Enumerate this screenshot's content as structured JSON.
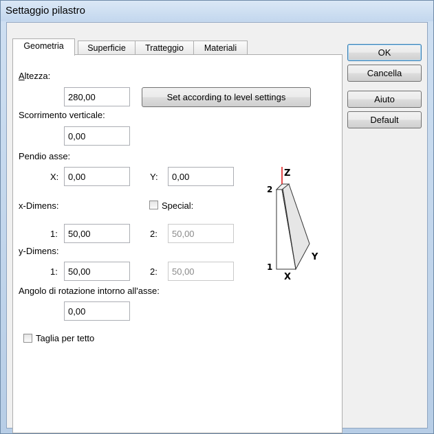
{
  "window": {
    "title": "Settaggio pilastro"
  },
  "tabs": [
    {
      "label": "Geometria",
      "active": true
    },
    {
      "label": "Superficie",
      "active": false
    },
    {
      "label": "Tratteggio",
      "active": false
    },
    {
      "label": "Materiali",
      "active": false
    }
  ],
  "buttons": {
    "ok": "OK",
    "cancel": "Cancella",
    "help": "Aiuto",
    "default": "Default"
  },
  "geometria": {
    "altezza_label_first": "A",
    "altezza_label_rest": "ltezza:",
    "altezza_value": "280,00",
    "level_button": "Set according to level settings",
    "scorrimento_label": "Scorrimento verticale:",
    "scorrimento_value": "0,00",
    "pendio_label": "Pendio asse:",
    "pendio_x_label": "X:",
    "pendio_x_value": "0,00",
    "pendio_y_label": "Y:",
    "pendio_y_value": "0,00",
    "xdim_label": "x-Dimens:",
    "special_label": "Special:",
    "special_checked": false,
    "xdim_1_label": "1:",
    "xdim_1_value": "50,00",
    "xdim_2_label": "2:",
    "xdim_2_value": "50,00",
    "ydim_label": "y-Dimens:",
    "ydim_1_label": "1:",
    "ydim_1_value": "50,00",
    "ydim_2_label": "2:",
    "ydim_2_value": "50,00",
    "angolo_label": "Angolo di rotazione intorno all'asse:",
    "angolo_value": "0,00",
    "taglia_label": "Taglia per tetto",
    "taglia_checked": false
  },
  "diagram": {
    "z": "Z",
    "x": "X",
    "y": "Y",
    "n1": "1",
    "n2": "2"
  }
}
